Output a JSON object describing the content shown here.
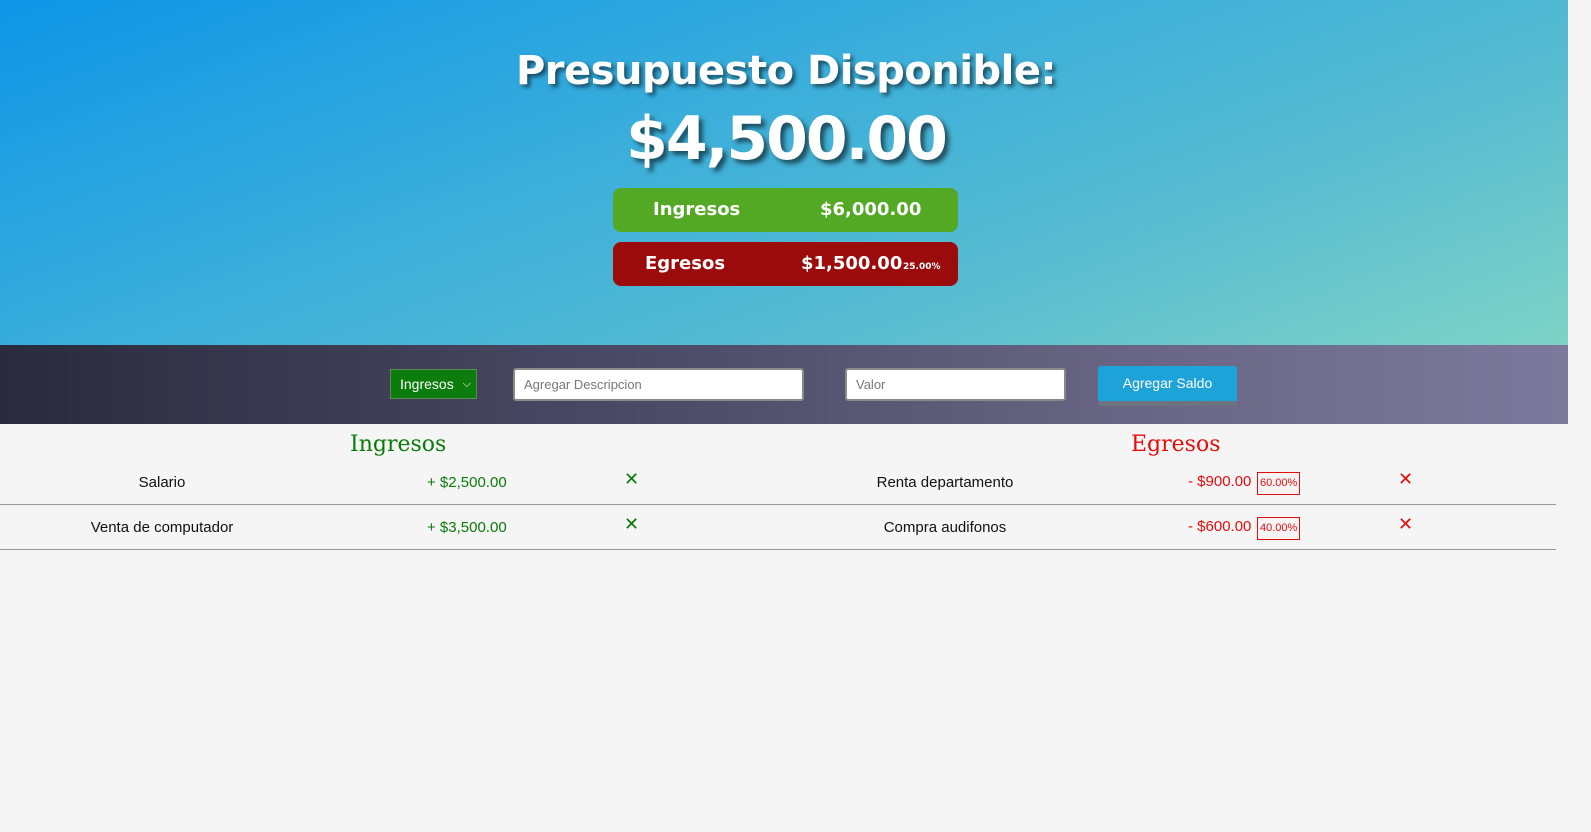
{
  "header": {
    "title": "Presupuesto Disponible:",
    "available_amount": "$4,500.00",
    "income_summary": {
      "label": "Ingresos",
      "amount": "$6,000.00",
      "color": "#53a824"
    },
    "expense_summary": {
      "label": "Egresos",
      "amount": "$1,500.00",
      "percent": "25.00%",
      "color": "#9b0b0c"
    }
  },
  "form": {
    "type_select": {
      "selected": "Ingresos",
      "options": [
        "Ingresos"
      ]
    },
    "description_placeholder": "Agregar Descripcion",
    "value_placeholder": "Valor",
    "submit_label": "Agregar Saldo"
  },
  "income": {
    "title": "Ingresos",
    "items": [
      {
        "description": "Salario",
        "value": "+ $2,500.00"
      },
      {
        "description": "Venta de computador",
        "value": "+ $3,500.00"
      }
    ]
  },
  "expenses": {
    "title": "Egresos",
    "items": [
      {
        "description": "Renta departamento",
        "value": "- $900.00",
        "percent": "60.00%"
      },
      {
        "description": "Compra audifonos",
        "value": "- $600.00",
        "percent": "40.00%"
      }
    ]
  },
  "icons": {
    "delete": "close-icon"
  },
  "colors": {
    "income": "#0a7a0a",
    "expense": "#e60c0c",
    "button": "#1da3d8"
  }
}
